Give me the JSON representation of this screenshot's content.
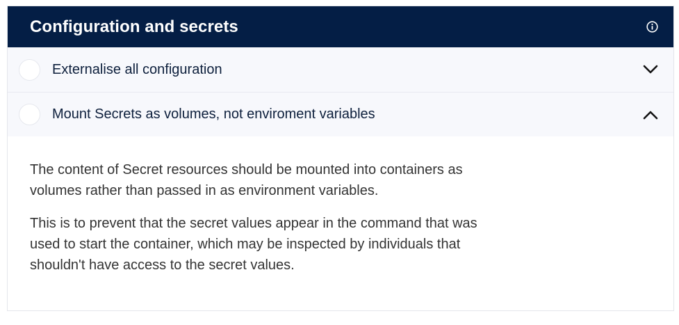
{
  "header": {
    "title": "Configuration and secrets",
    "info_icon": "info-circle-icon",
    "background": "#041e45"
  },
  "items": [
    {
      "label": "Externalise all configuration",
      "expanded": false,
      "chevron_icon": "chevron-down-icon"
    },
    {
      "label": "Mount Secrets as volumes, not enviroment variables",
      "expanded": true,
      "chevron_icon": "chevron-up-icon"
    }
  ],
  "expanded_content": {
    "paragraphs": [
      "The content of Secret resources should be mounted into containers as volumes rather than passed in as environment variables.",
      "This is to prevent that the secret values appear in the command that was used to start the container, which may be inspected by individuals that shouldn't have access to the secret values."
    ]
  }
}
